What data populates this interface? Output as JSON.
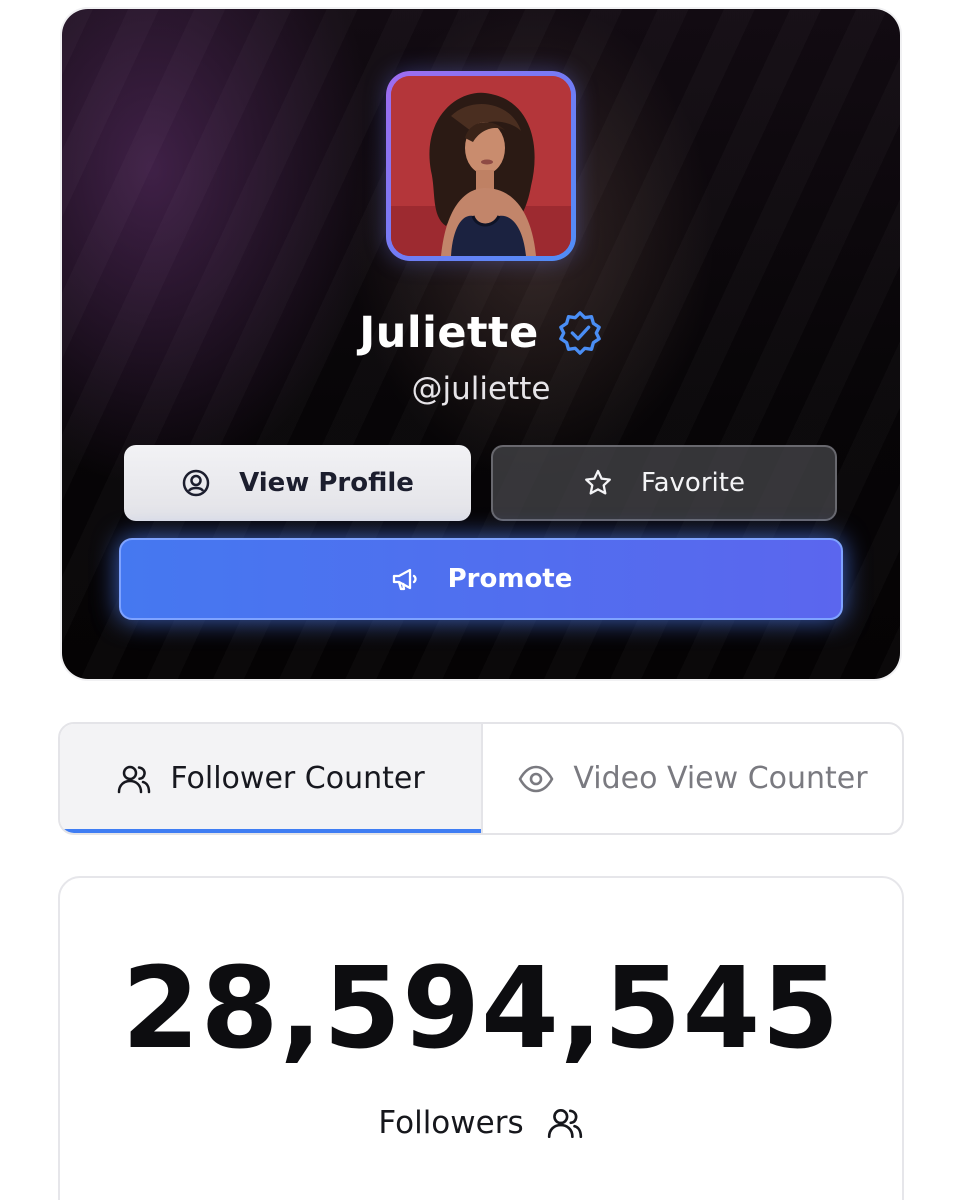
{
  "profile": {
    "name": "Juliette",
    "handle": "@juliette",
    "verified": true,
    "avatar_description_icon": "profile-photo"
  },
  "actions": {
    "view_profile_label": "View Profile",
    "favorite_label": "Favorite",
    "promote_label": "Promote"
  },
  "tabs": [
    {
      "label": "Follower Counter",
      "icon": "users-icon",
      "active": true
    },
    {
      "label": "Video View Counter",
      "icon": "eye-icon",
      "active": false
    }
  ],
  "counter": {
    "value": "28,594,545",
    "label": "Followers",
    "icon": "users-icon"
  },
  "colors": {
    "accent": "#3f7df3",
    "promote_start": "#4578f0",
    "promote_end": "#5b66ee",
    "verified": "#4a8ef5"
  }
}
